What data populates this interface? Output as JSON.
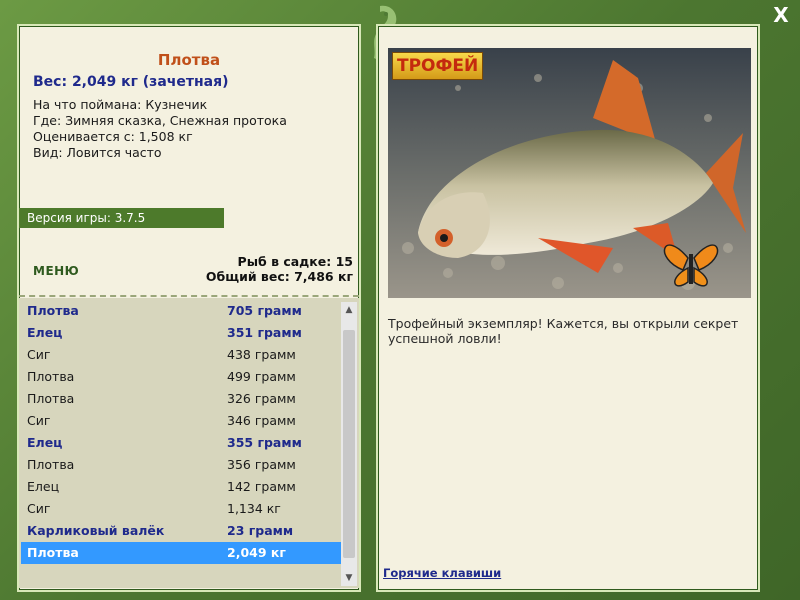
{
  "window": {
    "close_label": "X"
  },
  "fish": {
    "title": "Плотва",
    "weight": "Вес: 2,049 кг (зачетная)",
    "bait": "На что поймана: Кузнечик",
    "place": "Где: Зимняя сказка, Снежная протока",
    "rated_from": "Оценивается с: 1,508 кг",
    "kind": "Вид: Ловится часто"
  },
  "version": "Версия игры: 3.7.5",
  "menu_label": "МЕНЮ",
  "stats": {
    "fish_in_cage": "Рыб в садке: 15",
    "total_weight": "Общий вес: 7,486 кг"
  },
  "catch_list": [
    {
      "name": "Плотва",
      "weight": "705 грамм",
      "highlight": true
    },
    {
      "name": "Елец",
      "weight": "351 грамм",
      "highlight": true
    },
    {
      "name": "Сиг",
      "weight": "438 грамм",
      "highlight": false
    },
    {
      "name": "Плотва",
      "weight": "499 грамм",
      "highlight": false
    },
    {
      "name": "Плотва",
      "weight": "326 грамм",
      "highlight": false
    },
    {
      "name": "Сиг",
      "weight": "346 грамм",
      "highlight": false
    },
    {
      "name": "Елец",
      "weight": "355 грамм",
      "highlight": true
    },
    {
      "name": "Плотва",
      "weight": "356 грамм",
      "highlight": false
    },
    {
      "name": "Елец",
      "weight": "142 грамм",
      "highlight": false
    },
    {
      "name": "Сиг",
      "weight": "1,134 кг",
      "highlight": false
    },
    {
      "name": "Карликовый валёк",
      "weight": "23 грамм",
      "highlight": true
    },
    {
      "name": "Плотва",
      "weight": "2,049 кг",
      "highlight": true,
      "selected": true
    }
  ],
  "trophy": {
    "badge": "ТРОФЕЙ",
    "message": "Трофейный экземпляр! Кажется, вы открыли секрет успешной ловли!"
  },
  "hotkeys_label": "Горячие клавиши",
  "colors": {
    "frame": "#4f7a34",
    "panel": "#f4f1e0",
    "selection": "#3399ff",
    "accent_blue": "#1f2a8c",
    "title_orange": "#c0501a"
  }
}
